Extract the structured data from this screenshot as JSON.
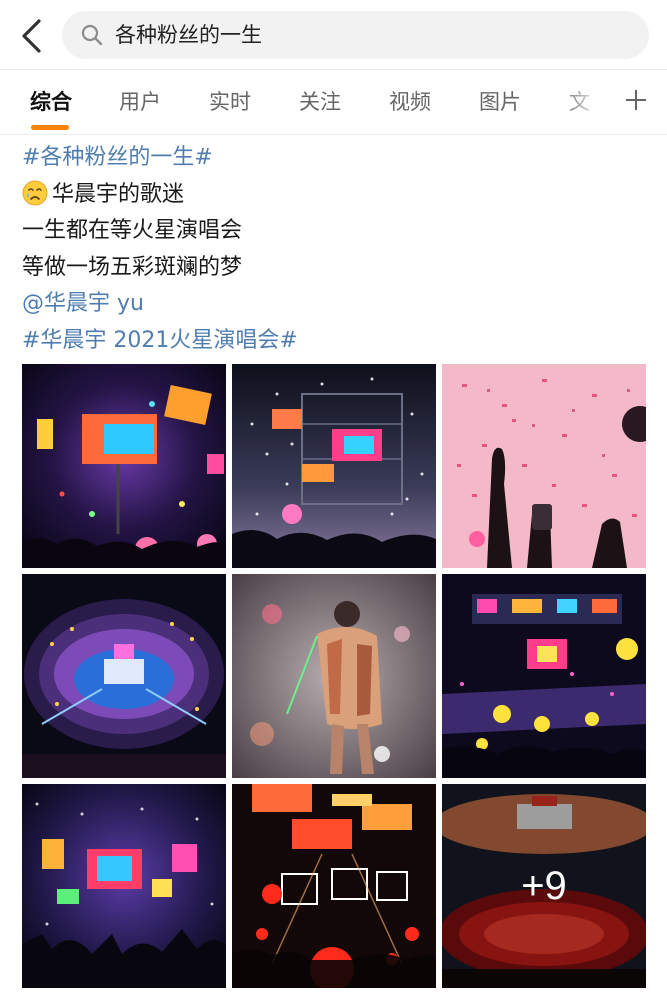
{
  "search": {
    "query": "各种粉丝的一生",
    "back_icon": "chevron-left-icon",
    "search_icon": "magnifier-icon"
  },
  "tabs": {
    "items": [
      "综合",
      "用户",
      "实时",
      "关注",
      "视频",
      "图片",
      "文"
    ],
    "active": "综合",
    "accent_color": "#ff8200",
    "add_icon": "plus-icon"
  },
  "post": {
    "topic_tag": "#各种粉丝的一生#",
    "emoji": "crying-face-emoji",
    "line1": "华晨宇的歌迷",
    "line2": "一生都在等火星演唱会",
    "line3": "等做一场五彩斑斓的梦",
    "mention": "@华晨宇 yu",
    "concert_tag": "#华晨宇 2021火星演唱会#",
    "link_color": "#507daf"
  },
  "images": {
    "descriptions": [
      "colorful-stage-screens",
      "stage-with-confetti",
      "pink-confetti-hands",
      "stadium-aerial-view",
      "singer-performing",
      "stage-with-orange-lights",
      "stage-screens-crowd",
      "stage-red-lights",
      "stadium-red-seats"
    ],
    "more_count": "+9"
  }
}
